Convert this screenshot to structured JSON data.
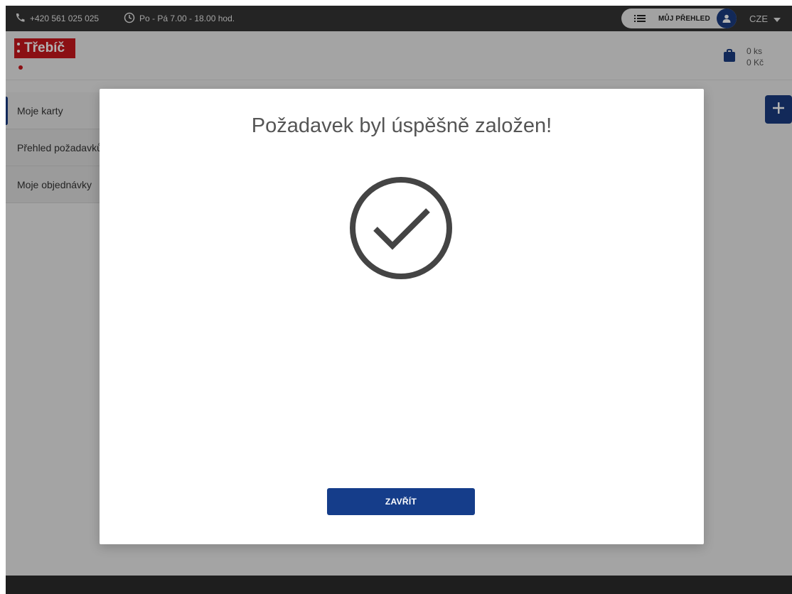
{
  "topbar": {
    "phone": "+420 561 025 025",
    "hours": "Po - Pá 7.00 - 18.00 hod.",
    "overview_label": "MŮJ PŘEHLED",
    "language": "CZE"
  },
  "header": {
    "logo_text": "Třebíč",
    "cart_count": "0 ks",
    "cart_total": "0 Kč"
  },
  "sidebar": {
    "items": [
      {
        "label": "Moje karty"
      },
      {
        "label": "Přehled požadavků"
      },
      {
        "label": "Moje objednávky"
      }
    ]
  },
  "modal": {
    "title": "Požadavek byl úspěšně založen!",
    "close_label": "ZAVŘÍT"
  },
  "colors": {
    "accent": "#1a3c80",
    "brand_red": "#c8171d",
    "topbar": "#343434"
  },
  "icons": [
    "phone-icon",
    "clock-icon",
    "list-icon",
    "user-icon",
    "caret-down-icon",
    "shopping-bag-icon",
    "plus-icon",
    "check-circle-icon"
  ]
}
